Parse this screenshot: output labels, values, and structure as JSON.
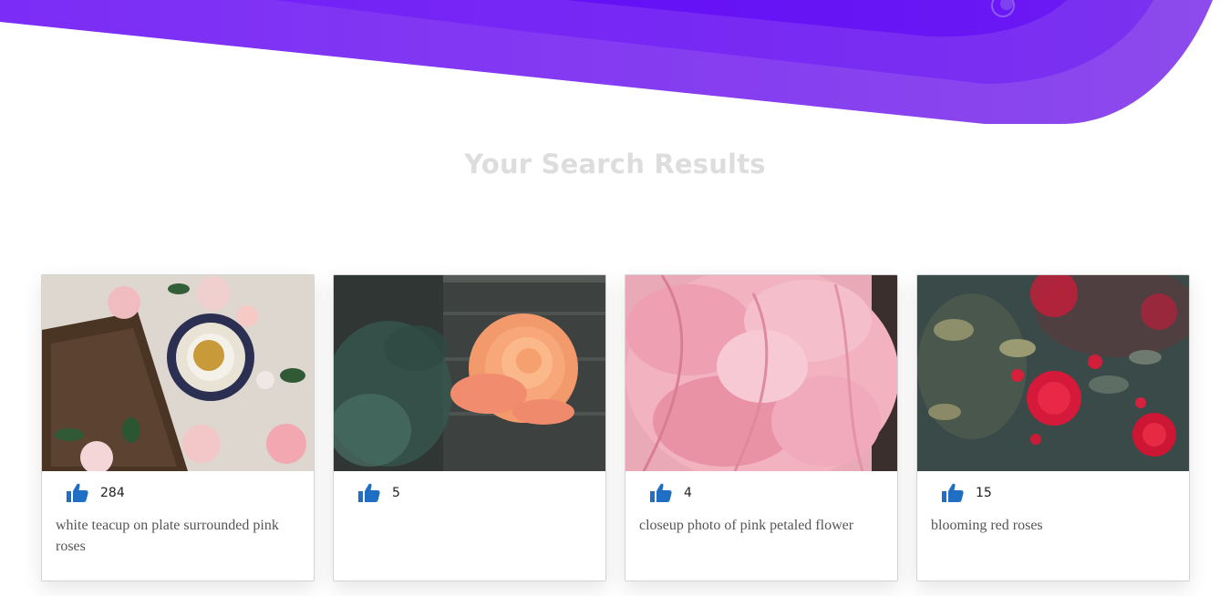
{
  "page": {
    "heading": "Your Search Results"
  },
  "colors": {
    "hero_dark": "#6a16f5",
    "hero_mid": "#7a2ef3",
    "hero_light": "#8b48ec",
    "heading": "#dddddd",
    "like_icon": "#1f6fc4"
  },
  "results": [
    {
      "image": "white teacup on plate surrounded pink roses photo",
      "like_icon": "thumbs-up-icon",
      "likes": "284",
      "caption": "white teacup on plate surrounded pink roses"
    },
    {
      "image": "orange rose photo",
      "like_icon": "thumbs-up-icon",
      "likes": "5",
      "caption": ""
    },
    {
      "image": "closeup pink petaled flower photo",
      "like_icon": "thumbs-up-icon",
      "likes": "4",
      "caption": "closeup photo of pink petaled flower"
    },
    {
      "image": "blooming red roses photo",
      "like_icon": "thumbs-up-icon",
      "likes": "15",
      "caption": "blooming red roses"
    }
  ]
}
